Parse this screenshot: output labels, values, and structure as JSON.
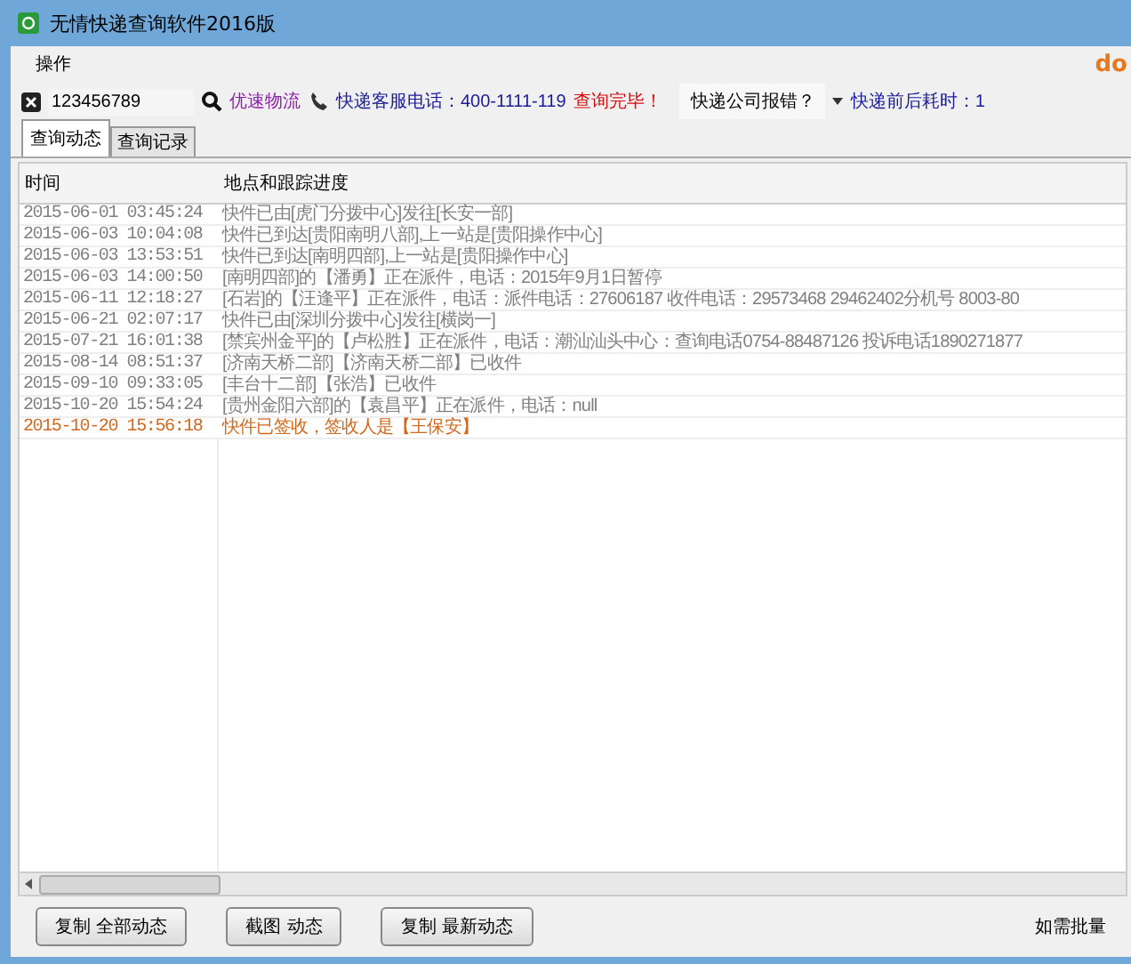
{
  "window": {
    "title": "无情快递查询软件2016版",
    "logo_text": "do"
  },
  "menu": [
    "操作"
  ],
  "toolbar": {
    "tracking_number": "123456789",
    "company": "优速物流",
    "hotline": "快递客服电话：400-1111-119",
    "status": "查询完毕！",
    "report": "快递公司报错？",
    "elapsed": "快递前后耗时：1"
  },
  "tabs": [
    {
      "label": "查询动态",
      "selected": true
    },
    {
      "label": "查询记录",
      "selected": false
    }
  ],
  "table": {
    "columns": [
      "时间",
      "地点和跟踪进度"
    ],
    "rows": [
      {
        "time": "2015-06-01 03:45:24",
        "progress": "快件已由[虎门分拨中心]发往[长安一部]",
        "color": "#808080"
      },
      {
        "time": "2015-06-03 10:04:08",
        "progress": "快件已到达[贵阳南明八部],上一站是[贵阳操作中心]",
        "color": "#808080"
      },
      {
        "time": "2015-06-03 13:53:51",
        "progress": "快件已到达[南明四部],上一站是[贵阳操作中心]",
        "color": "#808080"
      },
      {
        "time": "2015-06-03 14:00:50",
        "progress": "[南明四部]的【潘勇】正在派件，电话：2015年9月1日暂停",
        "color": "#808080"
      },
      {
        "time": "2015-06-11 12:18:27",
        "progress": "[石岩]的【汪逢平】正在派件，电话：派件电话：27606187 收件电话：29573468 29462402分机号 8003-80",
        "color": "#808080"
      },
      {
        "time": "2015-06-21 02:07:17",
        "progress": "快件已由[深圳分拨中心]发往[横岗一]",
        "color": "#808080"
      },
      {
        "time": "2015-07-21 16:01:38",
        "progress": "[禁宾州金平]的【卢松胜】正在派件，电话：潮汕汕头中心：查询电话0754-88487126  投诉电话1890271877",
        "color": "#808080"
      },
      {
        "time": "2015-08-14 08:51:37",
        "progress": "[济南天桥二部]【济南天桥二部】已收件",
        "color": "#808080"
      },
      {
        "time": "2015-09-10 09:33:05",
        "progress": "[丰台十二部]【张浩】已收件",
        "color": "#808080"
      },
      {
        "time": "2015-10-20 15:54:24",
        "progress": "[贵州金阳六部]的【袁昌平】正在派件，电话：null",
        "color": "#808080"
      },
      {
        "time": "2015-10-20 15:56:18",
        "progress": "快件已签收，签收人是【王保安】",
        "color": "#d2691e"
      }
    ]
  },
  "buttons": [
    "复制 全部动态",
    "截图 动态",
    "复制 最新动态"
  ],
  "footer_note": "如需批量"
}
